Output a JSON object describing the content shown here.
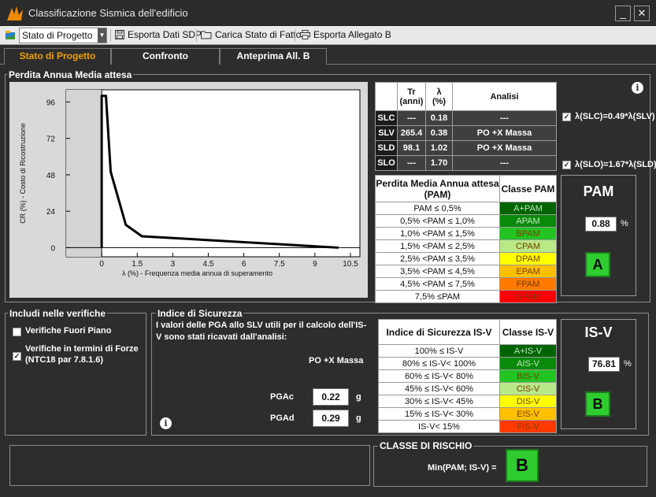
{
  "window": {
    "title": "Classificazione Sismica dell'edificio",
    "minimize_glyph": "_",
    "close_glyph": "✕"
  },
  "toolbar": {
    "state_select": "Stato di Progetto",
    "export_sdp": "Esporta Dati SDP",
    "load_state": "Carica Stato di Fatto",
    "export_annex": "Esporta Allegato B"
  },
  "tabs": [
    "Stato di Progetto",
    "Confronto",
    "Anteprima All. B"
  ],
  "pam_section": {
    "legend": "Perdita Annua Media attesa",
    "chart_xlabel": "λ (%) - Frequenza media annua di superamento",
    "chart_ylabel": "CR (%) - Costo di Ricostruzione",
    "tr_table": {
      "headers": [
        "",
        "Tr\n(anni)",
        "λ\n(%)",
        "Analisi"
      ],
      "rows": [
        {
          "label": "SLC",
          "tr": "---",
          "lambda": "0.18",
          "analysis": "---"
        },
        {
          "label": "SLV",
          "tr": "265.4",
          "lambda": "0.38",
          "analysis": "PO  +X Massa"
        },
        {
          "label": "SLD",
          "tr": "98.1",
          "lambda": "1.02",
          "analysis": "PO  +X Massa"
        },
        {
          "label": "SLO",
          "tr": "---",
          "lambda": "1.70",
          "analysis": "---"
        }
      ]
    },
    "slc_check": "λ(SLC)=0.49*λ(SLV)",
    "slo_check": "λ(SLO)=1.67*λ(SLD)",
    "class_table": {
      "header_range": "Perdita Media Annua attesa (PAM)",
      "header_class": "Classe PAM",
      "rows": [
        {
          "range": "PAM ≤ 0,5%",
          "cls": "A+PAM",
          "color": "#006400"
        },
        {
          "range": "0,5% <PAM ≤ 1,0%",
          "cls": "APAM",
          "color": "#0a8a0a"
        },
        {
          "range": "1,0% <PAM ≤ 1,5%",
          "cls": "BPAM",
          "color": "#22c422"
        },
        {
          "range": "1,5% <PAM ≤ 2,5%",
          "cls": "CPAM",
          "color": "#b8e986"
        },
        {
          "range": "2,5% <PAM ≤ 3,5%",
          "cls": "DPAM",
          "color": "#ffff00"
        },
        {
          "range": "3,5% <PAM ≤ 4,5%",
          "cls": "EPAM",
          "color": "#ffc000"
        },
        {
          "range": "4,5% <PAM ≤ 7,5%",
          "cls": "FPAM",
          "color": "#ff7a00"
        },
        {
          "range": "7,5% ≤PAM",
          "cls": "GPAM",
          "color": "#ff0000"
        }
      ]
    },
    "result_title": "PAM",
    "result_value": "0.88",
    "result_unit": "%",
    "result_class": "A"
  },
  "chart_data": {
    "type": "line",
    "x": [
      0,
      0,
      0.18,
      0.38,
      1.02,
      1.7,
      10.0
    ],
    "y": [
      0,
      100,
      100,
      50,
      15,
      7.5,
      0
    ],
    "xlabel": "λ (%) - Frequenza media annua di superamento",
    "ylabel": "CR (%) - Costo di Ricostruzione",
    "xticks": [
      "0",
      "1.5",
      "3",
      "4.5",
      "6",
      "7.5",
      "9",
      "10.5"
    ],
    "yticks": [
      "0",
      "24",
      "48",
      "72",
      "96"
    ],
    "xlim": [
      -1.5,
      10.9
    ],
    "ylim": [
      -6,
      104
    ]
  },
  "verifiche": {
    "legend": "Includi nelle verifiche",
    "fuori_piano": "Verifiche Fuori Piano",
    "forze": "Verifiche in termini di Forze (NTC18 par 7.8.1.6)"
  },
  "isv_section": {
    "legend": "Indice di Sicurezza",
    "note": "I valori delle PGA allo SLV utili per il calcolo dell'IS-V sono stati ricavati dall'analisi:",
    "analysis": "PO  +X Massa",
    "pgac_label": "PGAc",
    "pgac_value": "0.22",
    "pgad_label": "PGAd",
    "pgad_value": "0.29",
    "unit": "g",
    "class_table": {
      "header_range": "Indice di Sicurezza IS-V",
      "header_class": "Classe IS-V",
      "rows": [
        {
          "range": "100% ≤ IS-V",
          "cls": "A+IS-V",
          "color": "#006400"
        },
        {
          "range": "80% ≤ IS-V< 100%",
          "cls": "AIS-V",
          "color": "#0a8a0a"
        },
        {
          "range": "60% ≤ IS-V< 80%",
          "cls": "BIS-V",
          "color": "#22c422"
        },
        {
          "range": "45% ≤ IS-V< 60%",
          "cls": "CIS-V",
          "color": "#b8e986"
        },
        {
          "range": "30% ≤ IS-V< 45%",
          "cls": "DIS-V",
          "color": "#ffff00"
        },
        {
          "range": "15% ≤ IS-V< 30%",
          "cls": "EIS-V",
          "color": "#ffc000"
        },
        {
          "range": "IS-V< 15%",
          "cls": "FIS-V",
          "color": "#ff3a00"
        }
      ]
    },
    "result_title": "IS-V",
    "result_value": "76.81",
    "result_unit": "%",
    "result_class": "B"
  },
  "risk": {
    "legend": "CLASSE DI RISCHIO",
    "label": "Min(PAM; IS-V) =",
    "class": "B"
  }
}
